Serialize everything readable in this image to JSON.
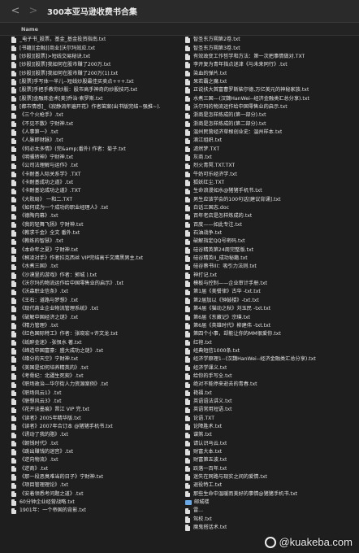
{
  "window": {
    "title": "300本亚马逊收费书合集",
    "back_glyph": "<",
    "forward_glyph": ">"
  },
  "header": {
    "name_col": "Name",
    "name_col_right": ""
  },
  "left_files": [
    "_电子书_股票，基金_基金投资指南.txt",
    "[书籍][金融][商业]沃尔玛效应.txt",
    "[炒股][股票]>短线交易秘诀.txt",
    "[炒股][股票]我如何在股市赚了200万.txt",
    "[炒股][股票]我如何在股市赚了200万(1).txt",
    "[股票]手写体一半儿--短线炒股最佳买卖点+++.txt",
    "[股票]手把手教你炒股：股市高手神奇的炒股技巧.txt",
    "[股票]金融炼金术[美]乔治·索罗斯.txt",
    "[都市情感]_《寂静流年遍开花》作者笛案(出书版完结~强推~).",
    "《三个火枪手》.txt",
    "《不见不散》宁财神.txt",
    "《人事第一》.txt",
    "《人脉即财脉》.txt",
    "《何必太多情》(完&amp;番外) 作者：菊子.txt",
    "《明骚转神》宁财神.txt",
    "《公司法理解与运作》.txt",
    "《卡耐基人际关系学》.TXT",
    "《卡耐基成功之道》.txt",
    "《卡耐基论成功之道》.TXT",
    "《大败局》 一和二.TXT",
    "《如何成为一个成功的职业经理人》.txt",
    "《德陶内幕》.txt",
    "《我的轻舞飞扬》宁财神.txt",
    "《教求千金》全文 番外.txt",
    "《教练的智慧》.txt",
    "《本命年之夏》宁财神.txt",
    "《桐凌对手》作者拉克西丝 VIP完结高千文鹰黑男主.txt",
    "《水煮三国》.txt",
    "《沙漠里的游戏》作者：郭城 ).txt",
    "《沃尔玛的物流运作给中国零售业的启示》.txt",
    "《沃森职业信条》.txt",
    "《王石：道路与梦想》.txt",
    "《现代商业企业物流管理系统》.txt",
    "《破解中国经济之谜》.txt",
    "《精力管理》.txt",
    "《红色国际特工》作者：张晓宏+许文龙.txt",
    "《纸醉金迷》-张恨水 著.txt",
    "《缔造中国富豪：盛大成功之谜》.txt",
    "《缘分的天空》宁财神.txt",
    "《美国是如何培养精英的》.txt",
    "《考骨纪：北疆生死契》.txt",
    "《职场政治—华尔街人力资源案例》.txt",
    "《职场风云1》.txt",
    "《联想风云3》.txt",
    "《花开淡墨痕》晋江 VIP 完.txt",
    "《读者》2005年精华版.txt",
    "《读者》2007年合订本 @猪猪手机书.txt",
    "《诱动了我的脂》.txt",
    "《朝钱时代》.txt",
    "《跳出赚钱的迷宫》.txt",
    "《逆向物流》.txt",
    "《逆商》.txt",
    "《那一段恶臭难当的日子》宁财神.txt",
    "《项目管理理论》.txt",
    "《安着领悉考问题之道》.txt",
    "60分钟企业经营战略.txt",
    "1901年：一个帝国的背影.txt"
  ],
  "right_files": [
    {
      "label": "智圣东方朔第2卷.txt",
      "icon": "file-icon"
    },
    {
      "label": "智圣东方朔第3卷.txt",
      "icon": "file-icon"
    },
    {
      "label": "有效政变工作哲学和方法：第一次把事情做对.TXT",
      "icon": "file-icon"
    },
    {
      "label": "李开复为青年指点迷津《与未来同行》.txt",
      "icon": "file-icon"
    },
    {
      "label": "染血的弹片.txt",
      "icon": "file-icon"
    },
    {
      "label": "呆若霸之魔.txt",
      "icon": "file-icon"
    },
    {
      "label": "正说扶大首富曹罗斯柴尔德,万亿美元的神秘家族.txt",
      "icon": "file-icon"
    },
    {
      "label": "水煮三国---(汉魏HanWei--经济金融类汇总分享).txt",
      "icon": "file-icon"
    },
    {
      "label": "沃尔玛的物流运作给中国零售业的启示.txt",
      "icon": "file-icon"
    },
    {
      "label": "浙商是怎样炼成的(第一部分).txt",
      "icon": "file-icon"
    },
    {
      "label": "浙商是怎样炼成的(第二部分).txt",
      "icon": "file-icon"
    },
    {
      "label": "温州民营经济草根创业史：温州样本.txt",
      "icon": "file-icon"
    },
    {
      "label": "滴江组织.txt",
      "icon": "file-icon"
    },
    {
      "label": "滤然梦.TXT",
      "icon": "file-icon"
    },
    {
      "label": "灰商.txt",
      "icon": "file-icon"
    },
    {
      "label": "烈火青冥.TXT.TXT",
      "icon": "file-icon"
    },
    {
      "label": "牛奶可乐经济学.txt",
      "icon": "file-icon"
    },
    {
      "label": "狐妖红尘.TXT",
      "icon": "file-icon"
    },
    {
      "label": "生命浪漫如水@猪猪手机书.txt",
      "icon": "file-icon"
    },
    {
      "label": "男生应该学会的100句话[建议背诵].txt",
      "icon": "file-icon"
    },
    {
      "label": "白话三国志.doc",
      "icon": "file-icon"
    },
    {
      "label": "百年老店是怎样炼成的.txt",
      "icon": "file-icon"
    },
    {
      "label": "百度——如此专注.txt",
      "icon": "file-icon"
    },
    {
      "label": "石油战争.txt",
      "icon": "file-icon"
    },
    {
      "label": "破解指定QQ号密码.txt",
      "icon": "file-icon"
    },
    {
      "label": "硅谷精英第24周完整版.txt",
      "icon": "file-icon"
    },
    {
      "label": "硅谷精英II_成功秘籍.txt",
      "icon": "file-icon"
    },
    {
      "label": "硅谷蔡书III：吸引力法则.txt",
      "icon": "file-icon"
    },
    {
      "label": "神打记.txt",
      "icon": "file-icon"
    },
    {
      "label": "模板与控制——企业审计手册.txt",
      "icon": "file-icon"
    },
    {
      "label": "第1届《美餐律》古华 -txt.txt",
      "icon": "file-icon"
    },
    {
      "label": "第2届加以《钟鼓楼》-txt.txt",
      "icon": "file-icon"
    },
    {
      "label": "第4届《猫动之秋》刘玉民 -txt.txt",
      "icon": "file-icon"
    },
    {
      "label": "第6届《东藏记》宗璞.txt",
      "icon": "file-icon"
    },
    {
      "label": "第6届《英雄时代》柳建伟 -txt.txt",
      "icon": "file-icon"
    },
    {
      "label": "第四个小事，却能让你的MM很爱你.txt",
      "icon": "file-icon"
    },
    {
      "label": "红袍.txt",
      "icon": "file-icon"
    },
    {
      "label": "经典短信1000条.txt",
      "icon": "file-icon"
    },
    {
      "label": "经济学原理1--(汉魏HanWei--经济金融类汇总分享).txt",
      "icon": "file-icon"
    },
    {
      "label": "经济学课义.txt",
      "icon": "file-icon"
    },
    {
      "label": "给你的手写全.txt",
      "icon": "file-icon"
    },
    {
      "label": "绝对不能停来逝去的青春.txt",
      "icon": "file-icon"
    },
    {
      "label": "艳福.txt",
      "icon": "file-icon"
    },
    {
      "label": "英语语法讲义.txt",
      "icon": "file-icon"
    },
    {
      "label": "英语常用短语.txt",
      "icon": "file-icon"
    },
    {
      "label": "论语.TXT",
      "icon": "file-icon"
    },
    {
      "label": "论障胜术.txt",
      "icon": "file-icon"
    },
    {
      "label": "谍煞.txt",
      "icon": "file-icon"
    },
    {
      "label": "请认识马云.txt",
      "icon": "file-icon"
    },
    {
      "label": "财富大本.txt",
      "icon": "file-icon"
    },
    {
      "label": "财富第五波.txt",
      "icon": "file-icon"
    },
    {
      "label": "跃落一百年.txt",
      "icon": "file-icon"
    },
    {
      "label": "迷失在网路与现实之间的爱情.txt",
      "icon": "file-icon"
    },
    {
      "label": "退役特工.txt",
      "icon": "file-icon"
    },
    {
      "label": "那些生命中温暖而美好的事情@猪猪手机书.txt",
      "icon": "file-icon"
    },
    {
      "label": "邮城楼",
      "icon": "folder-icon"
    },
    {
      "label": "雷...",
      "icon": "file-icon"
    },
    {
      "label": "驾校.txt",
      "icon": "file-icon"
    },
    {
      "label": "魔鬼搭话术.txt",
      "icon": "file-icon"
    }
  ],
  "watermark": {
    "text": "@kuakeba.com"
  }
}
